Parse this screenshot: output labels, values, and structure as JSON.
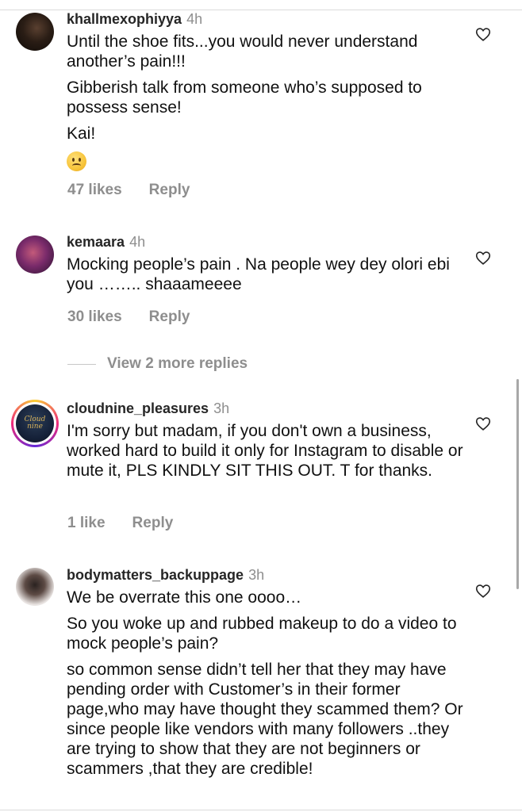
{
  "comments": [
    {
      "username": "khallmexophiyya",
      "time": "4h",
      "text": [
        "Until the shoe fits...you would never understand another’s pain!!!",
        "Gibberish talk from someone who’s supposed to possess sense!",
        "Kai!"
      ],
      "emoji": "frowning-face",
      "likes": "47 likes",
      "reply": "Reply"
    },
    {
      "username": "kemaara",
      "time": "4h",
      "text": [
        "Mocking people’s pain . Na people wey dey olori ebi you …….. shaaameeee"
      ],
      "likes": "30 likes",
      "reply": "Reply"
    },
    {
      "username": "cloudnine_pleasures",
      "time": "3h",
      "avatar_text": "Cloud nine",
      "text": [
        "I'm sorry but madam, if you don't own a business, worked hard to build it only for Instagram to disable or mute it, PLS KINDLY SIT THIS OUT. T for thanks."
      ],
      "likes": "1 like",
      "reply": "Reply"
    },
    {
      "username": "bodymatters_backuppage",
      "time": "3h",
      "text": [
        "We be overrate this one oooo…",
        "So you woke up and rubbed makeup to do a video to mock people’s pain?",
        "so common sense didn’t tell her that they may have pending order with Customer’s in their former page,who may have thought they scammed them? Or since people like vendors with many followers ..they are trying to show that they are not beginners or scammers ,that they are credible!"
      ]
    }
  ],
  "view_replies": "View 2 more replies"
}
